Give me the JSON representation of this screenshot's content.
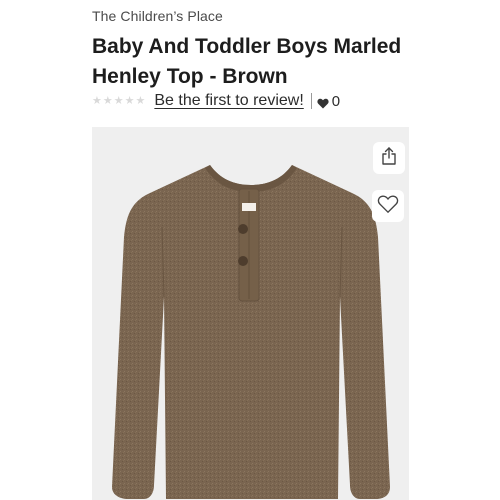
{
  "product": {
    "brand": "The Children’s Place",
    "title": "Baby And Toddler Boys Marled Henley Top - Brown"
  },
  "reviews": {
    "stars": [
      "★",
      "★",
      "★",
      "★",
      "★"
    ],
    "rating": 0,
    "link_label": "Be the first to review!",
    "favorites_count": "0"
  },
  "actions": {
    "share_icon": "share-icon",
    "wishlist_icon": "heart-outline-icon"
  },
  "colors": {
    "image_background": "#efefef",
    "shirt": "#7a6550",
    "star_empty": "#d9d9d9"
  }
}
